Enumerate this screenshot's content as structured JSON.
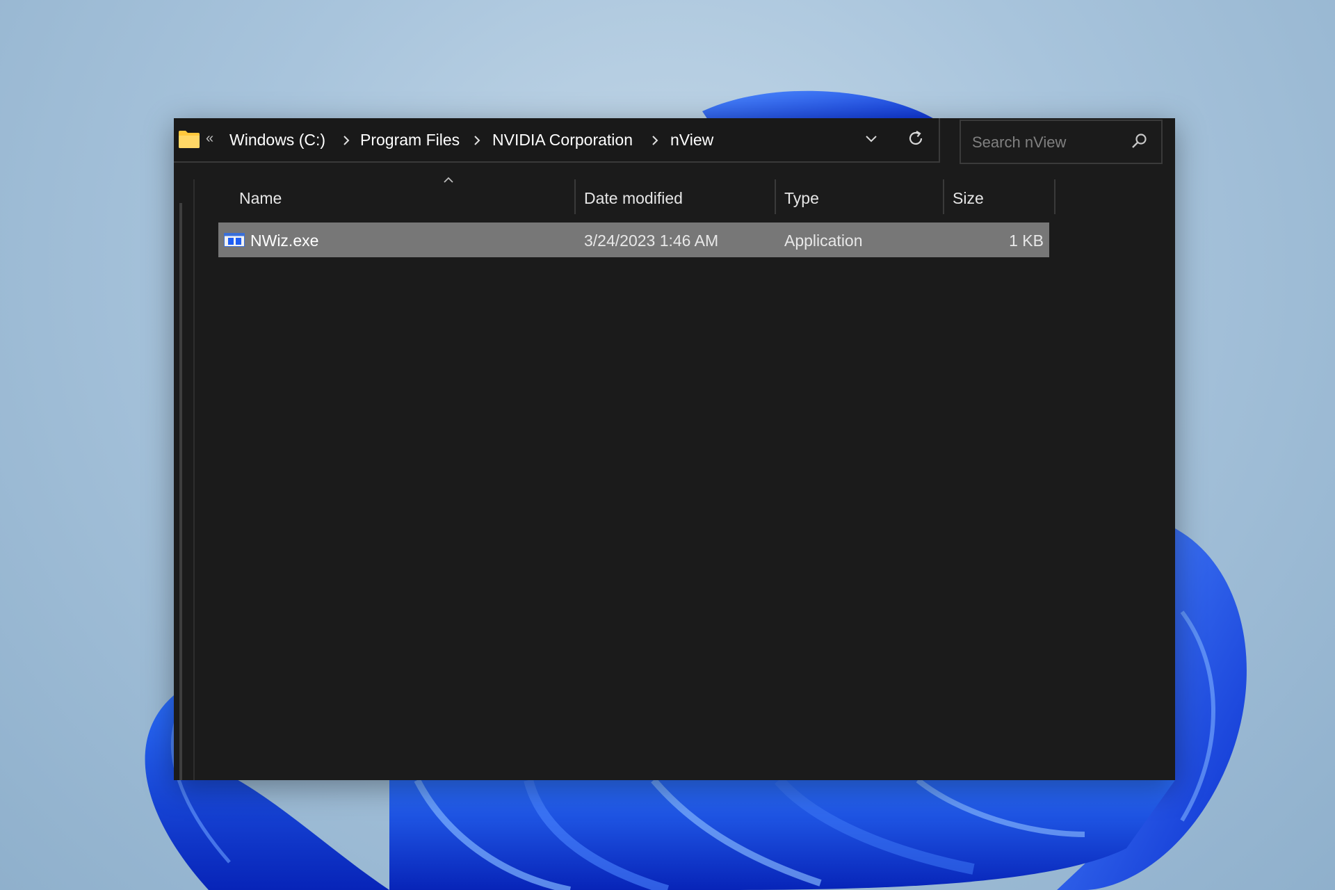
{
  "address_bar": {
    "overflow_glyph": "«",
    "crumbs": [
      "Windows (C:)",
      "Program Files",
      "NVIDIA Corporation",
      "nView"
    ]
  },
  "search": {
    "placeholder": "Search nView",
    "value": ""
  },
  "columns": {
    "name": "Name",
    "date_modified": "Date modified",
    "type": "Type",
    "size": "Size"
  },
  "files": [
    {
      "name": "NWiz.exe",
      "date_modified": "3/24/2023 1:46 AM",
      "type": "Application",
      "size": "1 KB",
      "selected": true
    }
  ],
  "colors": {
    "window_bg": "#1b1b1b",
    "selected_row_bg": "#777777",
    "folder_yellow": "#ffc83d",
    "accent_blue": "#1e5ef5"
  }
}
